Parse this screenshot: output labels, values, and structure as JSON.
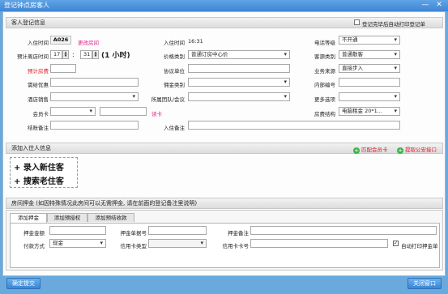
{
  "window": {
    "title": "登记钟点房客人",
    "minimize": "—",
    "close": "✕"
  },
  "guest_section": {
    "title": "客人登记信息",
    "auto_print_label": "登记完毕后自动打印登记单",
    "checkin_time_label": "入住时间",
    "room_no": "A026",
    "change_room": "更改房间",
    "checkin_at_label": "入住时间",
    "checkin_at_value": "16:31",
    "phone_level_label": "电话等级",
    "phone_level_value": "不开通",
    "expected_leave_label": "预计离店时间",
    "hour_value": "17",
    "minute_value": "31",
    "duration": "(1 小时)",
    "price_type_label": "价格类别",
    "price_type_value": "普通订房中心价",
    "guest_type_label": "客源类别",
    "guest_type_value": "普通散客",
    "deposit_label": "预计房费",
    "agreement_label": "协议单位",
    "source_label": "业务来源",
    "source_value": "直接步入",
    "discount_label": "需给优惠",
    "commission_label": "佣金类别",
    "internal_no_label": "内部编号",
    "sales_label": "酒店销售",
    "group_label": "所属团队/会议",
    "more_label": "更多选项",
    "member_label": "会员卡",
    "read_card": "读卡",
    "room_struct_label": "房费结构",
    "room_struct_value": "电脑租金 20*1...",
    "bill_note_label": "结账备注",
    "checkin_note_label": "入住备注"
  },
  "guests_section": {
    "title": "添加入住人信息",
    "match_member": "匹配会员卡",
    "public_security": "提取公安接口",
    "add_new": "+ 录入新住客",
    "search_old": "+ 搜索老住客"
  },
  "deposit_section": {
    "title": "房间押金 (如因特殊情况此房间可以无需押金, 请在前面的登记备注里说明)",
    "tabs": [
      "添加押金",
      "添加预授权",
      "添加预结收款"
    ],
    "amount_label": "押金金额",
    "receipt_label": "押金单据号",
    "note_label": "押金备注",
    "pay_method_label": "付款方式",
    "pay_method_value": "现金",
    "card_type_label": "信用卡类型",
    "card_no_label": "信用卡卡号",
    "auto_print_label": "自动打印押金单"
  },
  "footer": {
    "confirm": "确定提交",
    "close": "关闭窗口"
  }
}
